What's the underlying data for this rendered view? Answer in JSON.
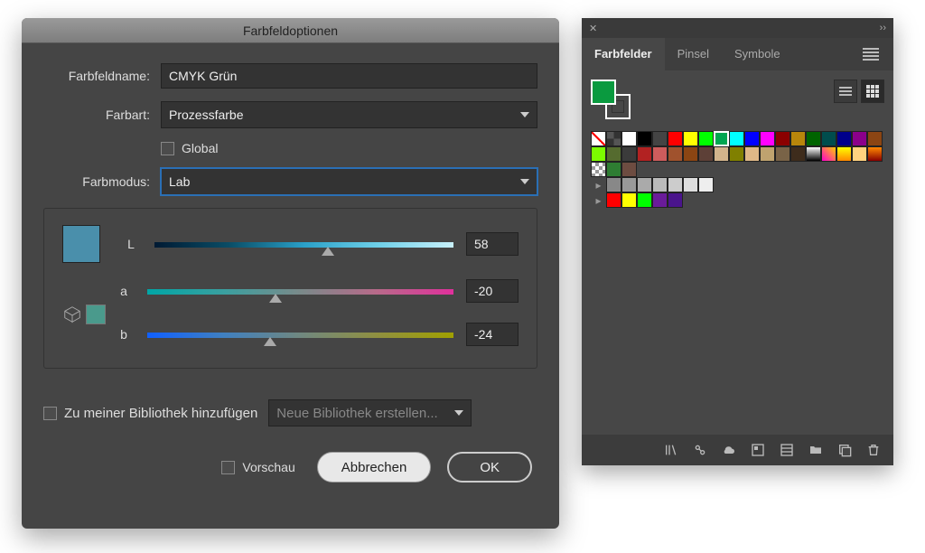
{
  "dialog": {
    "title": "Farbfeldoptionen",
    "name_label": "Farbfeldname:",
    "name_value": "CMYK Grün",
    "type_label": "Farbart:",
    "type_value": "Prozessfarbe",
    "global_label": "Global",
    "mode_label": "Farbmodus:",
    "mode_value": "Lab",
    "channels": {
      "L": {
        "label": "L",
        "value": "58",
        "pos": 58
      },
      "a": {
        "label": "a",
        "value": "-20",
        "pos": 42
      },
      "b": {
        "label": "b",
        "value": "-24",
        "pos": 40
      }
    },
    "library_label": "Zu meiner Bibliothek hinzufügen",
    "library_select": "Neue Bibliothek erstellen...",
    "preview_label": "Vorschau",
    "cancel": "Abbrechen",
    "ok": "OK",
    "preview_color": "#4a8fab"
  },
  "panel": {
    "tabs": [
      "Farbfelder",
      "Pinsel",
      "Symbole"
    ],
    "active_tab": 0,
    "fill_color": "#0a9a3f",
    "rows": [
      [
        "none",
        "reg",
        "#ffffff",
        "#000000",
        "#444444",
        "#ff0000",
        "#ffff00",
        "#00ff00",
        "#00a651:sel",
        "#00ffff",
        "#0000ff",
        "#ff00ff",
        "#8b0000",
        "#b8860b",
        "#006400",
        "#004d4d",
        "#00008b",
        "#8b008b",
        "#8b4513"
      ],
      [
        "#7cfc00",
        "#556b2f",
        "#3b3b3b",
        "#b22222",
        "#cd5c5c",
        "#a0522d",
        "#8b4513",
        "#5d4037",
        "#d2b48c",
        "#808000",
        "#deb887",
        "#bfa36f",
        "#796347",
        "#3e2c1c",
        "grad1",
        "grad2",
        "grad3",
        "#ffd27f",
        "grad4"
      ],
      [
        "trans",
        "#2e7d32",
        "#6d4c41"
      ],
      [
        "folder",
        "#888",
        "#999",
        "#aaa",
        "#bbb",
        "#ccc",
        "#ddd",
        "#eee"
      ],
      [
        "folder",
        "#ff0000",
        "#ffff00",
        "#00ff00",
        "#6a1b9a",
        "#4a148c"
      ]
    ],
    "footer_icons": [
      "library-icon",
      "link-icon",
      "cloud-icon",
      "swatch-options-icon",
      "list-icon",
      "folder-icon",
      "new-swatch-icon",
      "trash-icon"
    ]
  }
}
